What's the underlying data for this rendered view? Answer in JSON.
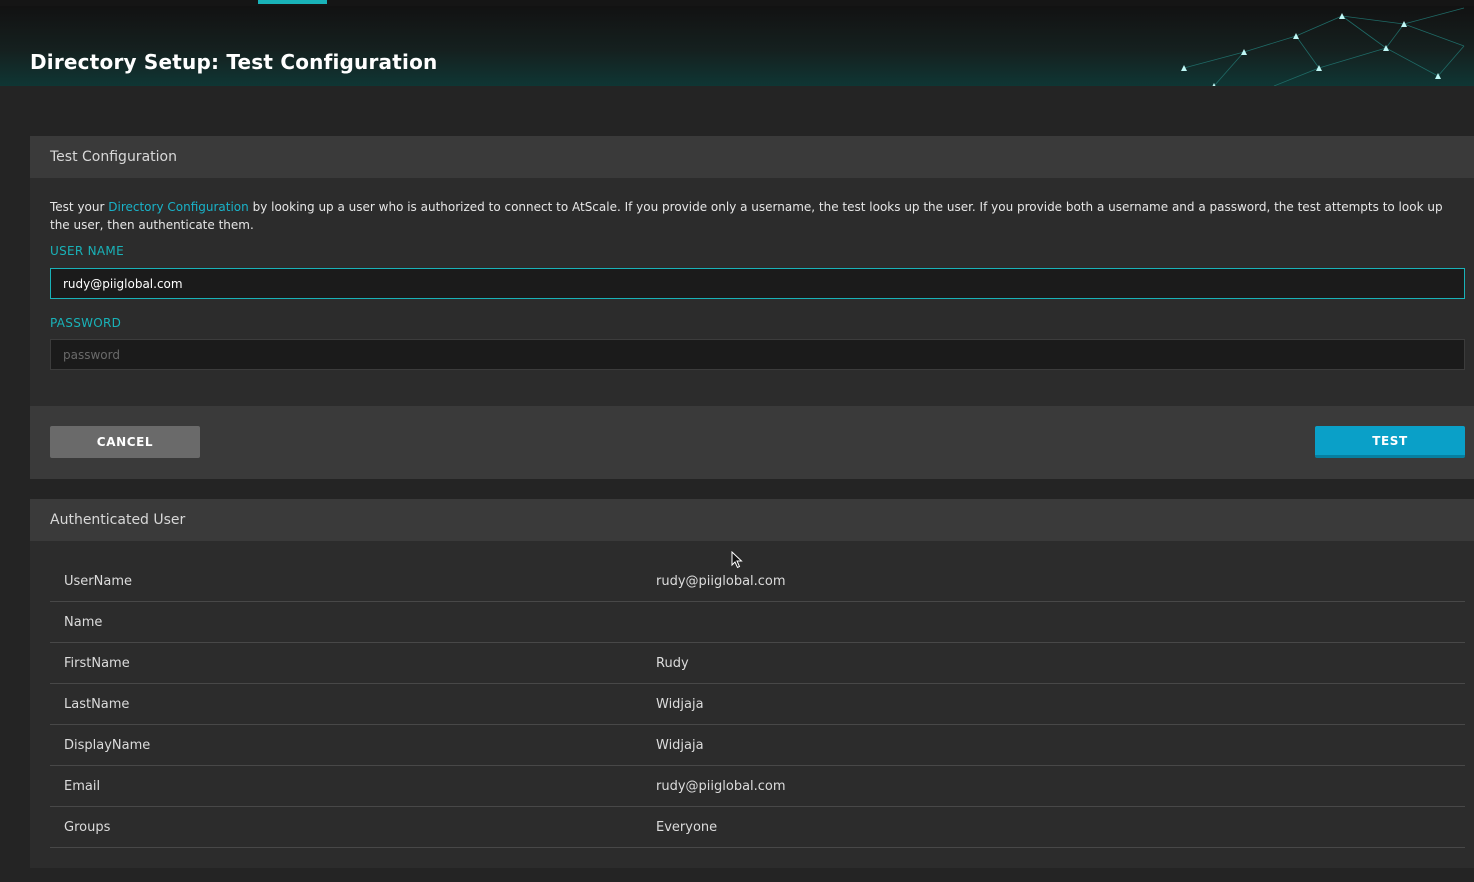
{
  "page": {
    "title": "Directory Setup: Test Configuration"
  },
  "test_panel": {
    "title": "Test Configuration",
    "description": {
      "prefix": "Test your ",
      "link": "Directory Configuration",
      "suffix": " by looking up a user who is authorized to connect to AtScale. If you provide only a username, the test looks up the user. If you provide both a username and a password, the test attempts to look up the user, then authenticate them."
    },
    "username": {
      "label": "USER NAME",
      "value": "rudy@piiglobal.com"
    },
    "password": {
      "label": "PASSWORD",
      "placeholder": "password"
    },
    "cancel_label": "CANCEL",
    "test_label": "TEST"
  },
  "auth_panel": {
    "title": "Authenticated User",
    "rows": [
      {
        "key": "UserName",
        "value": "rudy@piiglobal.com"
      },
      {
        "key": "Name",
        "value": ""
      },
      {
        "key": "FirstName",
        "value": "Rudy"
      },
      {
        "key": "LastName",
        "value": "Widjaja"
      },
      {
        "key": "DisplayName",
        "value": "Widjaja"
      },
      {
        "key": "Email",
        "value": "rudy@piiglobal.com"
      },
      {
        "key": "Groups",
        "value": "Everyone"
      }
    ]
  },
  "colors": {
    "accent": "#19b2b8",
    "test_button": "#0aa0c8",
    "cancel_button": "#6a6a6a"
  }
}
